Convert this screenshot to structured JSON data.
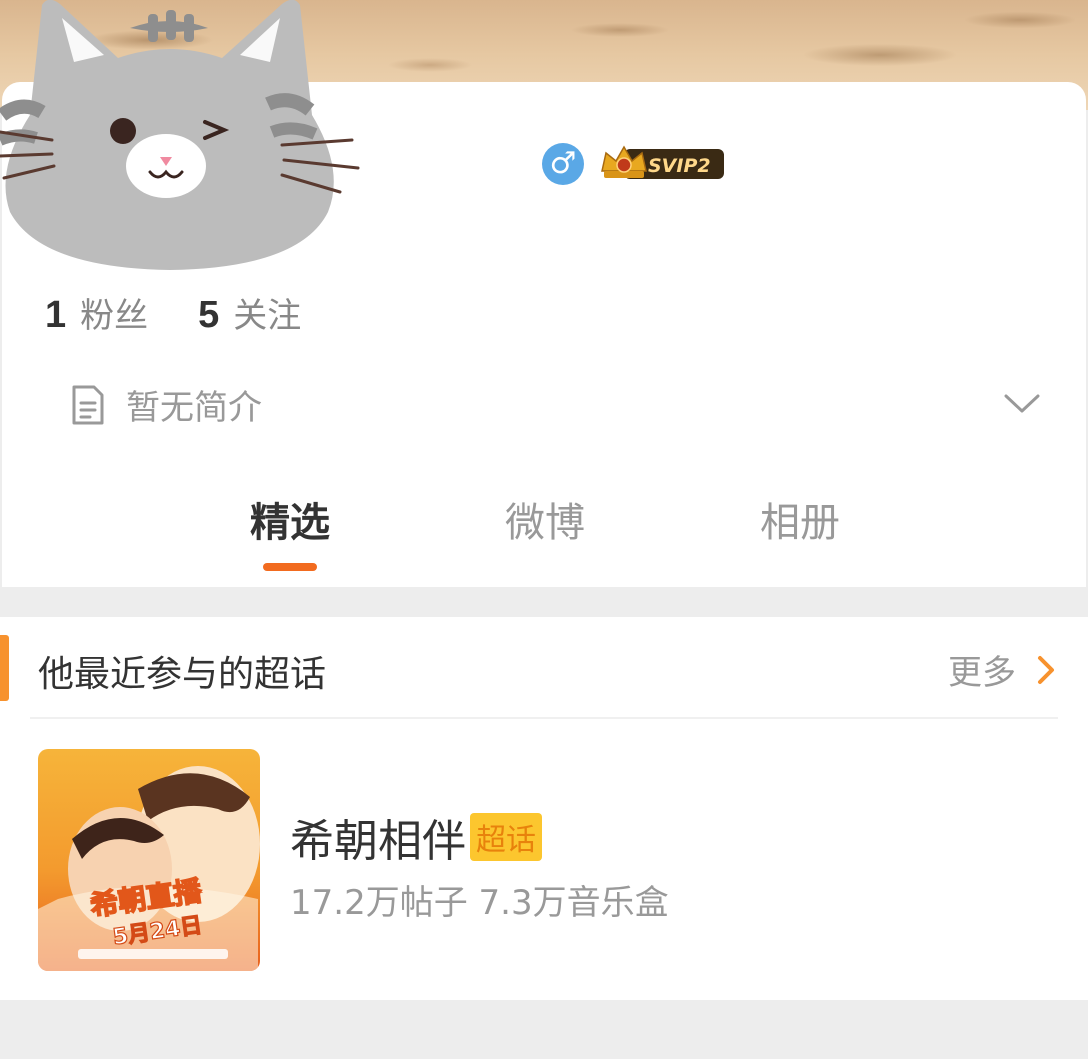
{
  "badges": {
    "gender_symbol": "♂",
    "vip_label": "SVIP2"
  },
  "stats": {
    "followers_count": "1",
    "followers_label": "粉丝",
    "following_count": "5",
    "following_label": "关注"
  },
  "bio": {
    "text": "暂无简介"
  },
  "tabs": [
    {
      "label": "精选",
      "active": true
    },
    {
      "label": "微博",
      "active": false
    },
    {
      "label": "相册",
      "active": false
    }
  ],
  "super_topics": {
    "title": "他最近参与的超话",
    "more_label": "更多",
    "items": [
      {
        "name": "希朝相伴",
        "tag": "超话",
        "stats": "17.2万帖子 7.3万音乐盒",
        "cover": {
          "headline": "希朝直播",
          "date": "5月24日"
        }
      }
    ]
  },
  "colors": {
    "accent": "#f26b1f",
    "gender_badge": "#5aa8e6",
    "topic_tag_bg": "#fcc62e",
    "section_accent": "#f7922e"
  }
}
